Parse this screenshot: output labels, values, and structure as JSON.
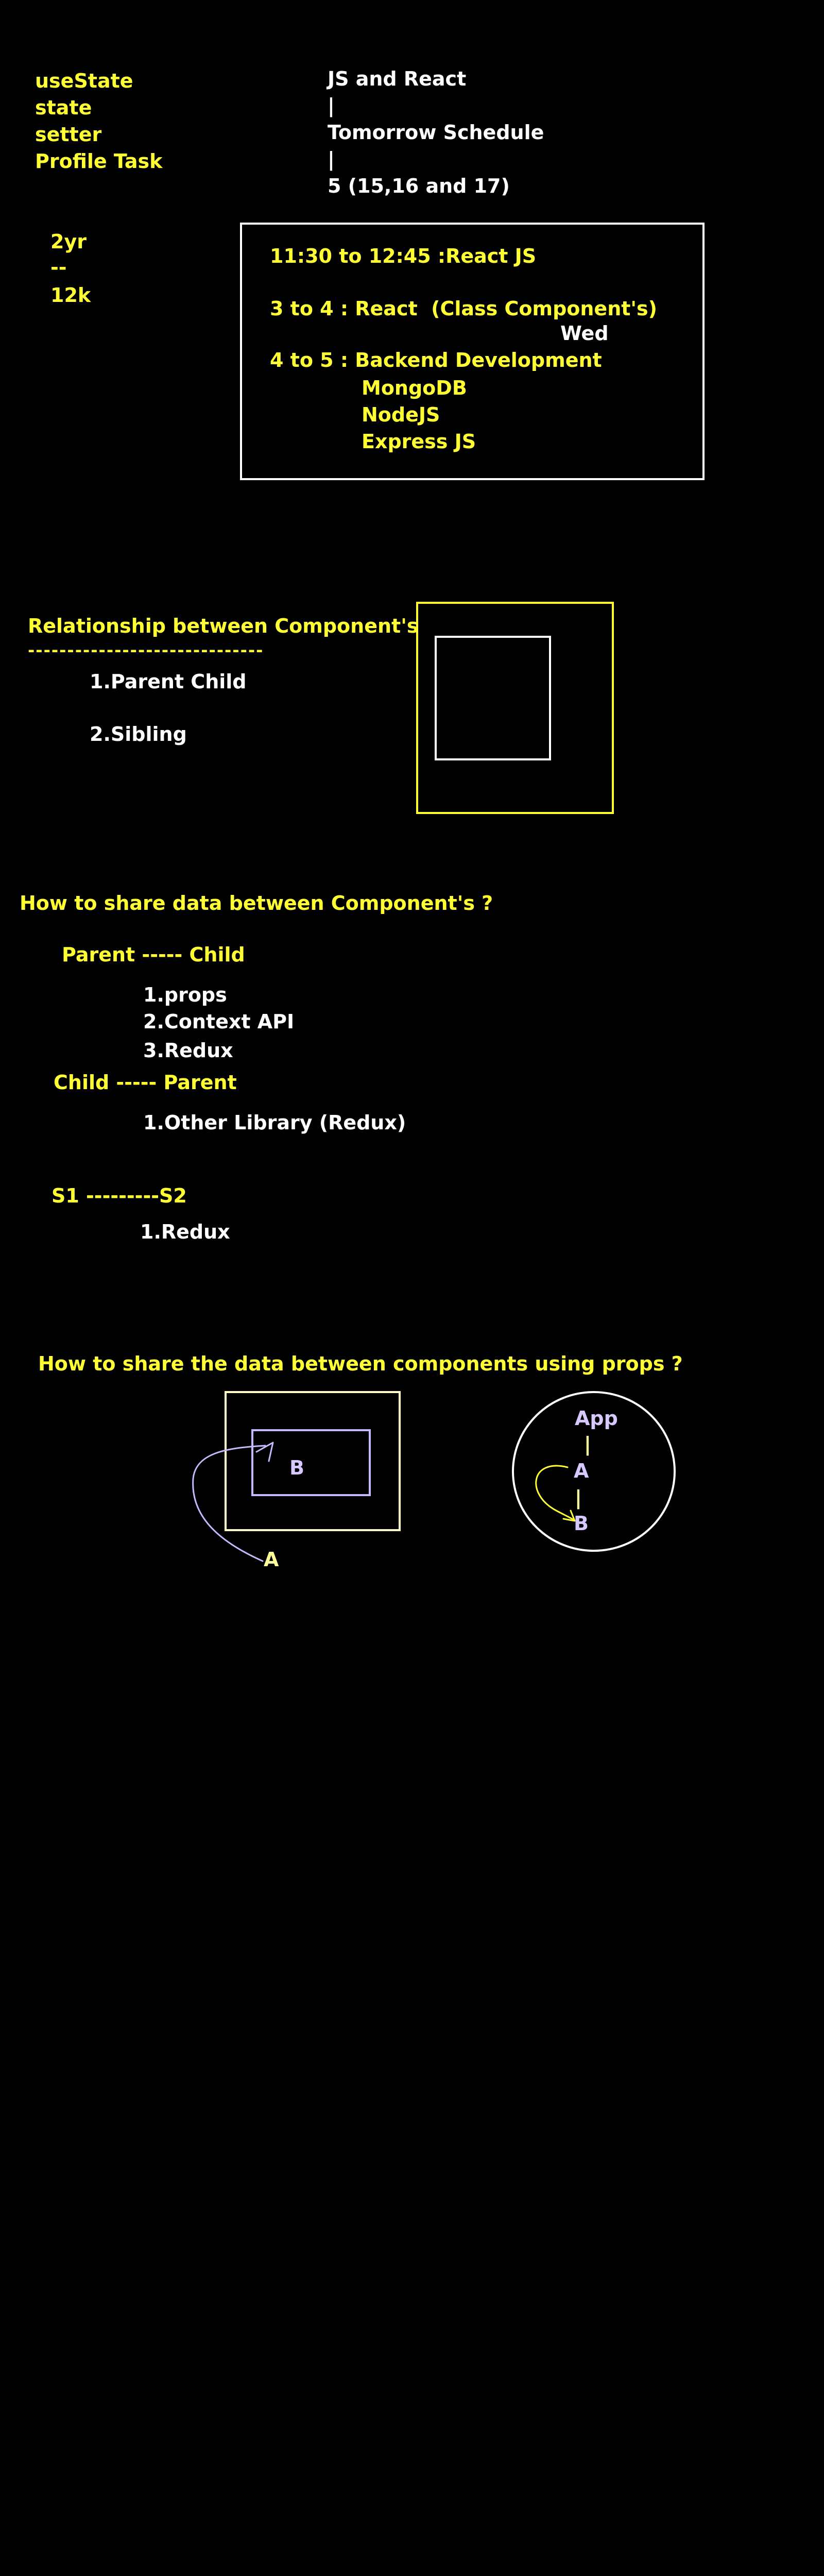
{
  "colors": {
    "background": "#000000",
    "yellow": "#ffff33",
    "white": "#ffffff",
    "lavender": "#d7c9ff"
  },
  "top_notes": {
    "left": [
      "useState",
      "state",
      "setter",
      "Profile Task"
    ],
    "right": [
      "JS and React",
      "|",
      "Tomorrow Schedule",
      "|",
      "5 (15,16 and 17)"
    ]
  },
  "salary_note": [
    "2yr",
    "--",
    "12k"
  ],
  "schedule": {
    "slot1": "11:30 to 12:45 :React JS",
    "slot2": "3 to 4 : React  (Class Component's)",
    "day": "Wed",
    "slot3": "4 to 5 : Backend Development",
    "backend_items": [
      "MongoDB",
      "NodeJS",
      "Express JS"
    ]
  },
  "relationship": {
    "title": "Relationship between Component's",
    "underline": "------------------------------",
    "items": [
      "1.Parent Child",
      "2.Sibling"
    ]
  },
  "share_data": {
    "title": "How to share data between Component's ?",
    "parent_child": "Parent ----- Child",
    "parent_child_methods": [
      "1.props",
      "2.Context API",
      "3.Redux"
    ],
    "child_parent": "Child ----- Parent",
    "child_parent_methods": [
      "1.Other Library (Redux)"
    ],
    "sibling": "S1 ---------S2",
    "sibling_methods": [
      "1.Redux"
    ]
  },
  "props_section": {
    "title": "How to share the data between components using props ?",
    "nested_inner_label": "B",
    "nested_outer_label": "A",
    "tree": [
      "App",
      "|",
      "A",
      "|",
      "B"
    ]
  }
}
